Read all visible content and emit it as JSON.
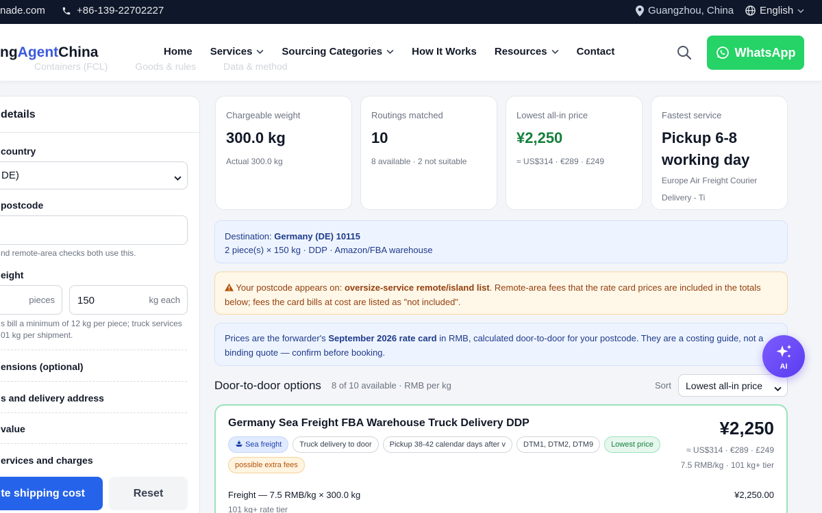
{
  "topbar": {
    "email": "nade.com",
    "phone": "+86-139-22702227",
    "location": "Guangzhou, China",
    "language": "English"
  },
  "header": {
    "logo_prefix": "ng",
    "logo_accent": "Agent",
    "logo_suffix": "China",
    "nav": [
      {
        "label": "Home",
        "dropdown": false
      },
      {
        "label": "Services",
        "dropdown": true
      },
      {
        "label": "Sourcing Categories",
        "dropdown": true
      },
      {
        "label": "How It Works",
        "dropdown": false
      },
      {
        "label": "Resources",
        "dropdown": true
      },
      {
        "label": "Contact",
        "dropdown": false
      }
    ],
    "ghost_tabs": [
      "Containers (FCL)",
      "Goods & rules",
      "Data & method"
    ],
    "whatsapp_label": "WhatsApp"
  },
  "left_panel": {
    "title": "details",
    "country_label": "country",
    "country_value": "DE)",
    "postcode_label": "postcode",
    "postcode_hint": "nd remote-area checks both use this.",
    "weight_label": "eight",
    "pieces_unit": "pieces",
    "weight_value": "150",
    "weight_unit": "kg each",
    "weight_hint_1": "s bill a minimum of 12 kg per piece; truck services",
    "weight_hint_2": "01 kg per shipment.",
    "sections": [
      "ensions (optional)",
      "s and delivery address",
      "value",
      "ervices and charges"
    ],
    "calculate_label": "te shipping cost",
    "reset_label": "Reset"
  },
  "stats": [
    {
      "label": "Chargeable weight",
      "value": "300.0 kg",
      "sub": "Actual 300.0 kg",
      "green": false
    },
    {
      "label": "Routings matched",
      "value": "10",
      "sub": "8 available · 2 not suitable",
      "green": false
    },
    {
      "label": "Lowest all-in price",
      "value": "¥2,250",
      "sub": "≈ US$314 · €289 · £249",
      "green": true
    },
    {
      "label": "Fastest service",
      "value": "Pickup 6-8 working day",
      "sub": "Europe Air Freight Courier Delivery - Ti",
      "green": false
    }
  ],
  "destination": {
    "label": "Destination:",
    "value": "Germany (DE) 10115",
    "line2": "2 piece(s) × 150 kg · DDP · Amazon/FBA warehouse"
  },
  "warning": {
    "pre": "Your postcode appears on:",
    "list": "oversize-service remote/island list",
    "post": ". Remote-area fees that the rate card prices are included in the totals below; fees the card bills at cost are listed as \"not included\"."
  },
  "info": {
    "pre": "Prices are the forwarder's",
    "card": "September 2026 rate card",
    "post": "in RMB, calculated door-to-door for your postcode. They are a costing guide, not a binding quote — confirm before booking."
  },
  "options": {
    "title": "Door-to-door options",
    "count": "8 of 10 available · RMB per kg",
    "sort_label": "Sort",
    "sort_value": "Lowest all-in price"
  },
  "result": {
    "title": "Germany Sea Freight FBA Warehouse Truck Delivery DDP",
    "tags": [
      {
        "text": "Sea freight",
        "style": "blue",
        "icon": "ship-icon"
      },
      {
        "text": "Truck delivery to door",
        "style": "plain"
      },
      {
        "text": "Pickup 38-42 calendar days after v",
        "style": "plain"
      },
      {
        "text": "DTM1, DTM2, DTM9",
        "style": "plain"
      },
      {
        "text": "Lowest price",
        "style": "green"
      },
      {
        "text": "possible extra fees",
        "style": "amber"
      }
    ],
    "price": "¥2,250",
    "conversion": "≈ US$314 · €289 · £249",
    "tier": "7.5 RMB/kg · 101 kg+ tier",
    "line_label": "Freight — 7.5 RMB/kg × 300.0 kg",
    "line_amount": "¥2,250.00",
    "line_sub": "101 kg+ rate tier"
  },
  "ai_fab": {
    "label": "AI"
  }
}
